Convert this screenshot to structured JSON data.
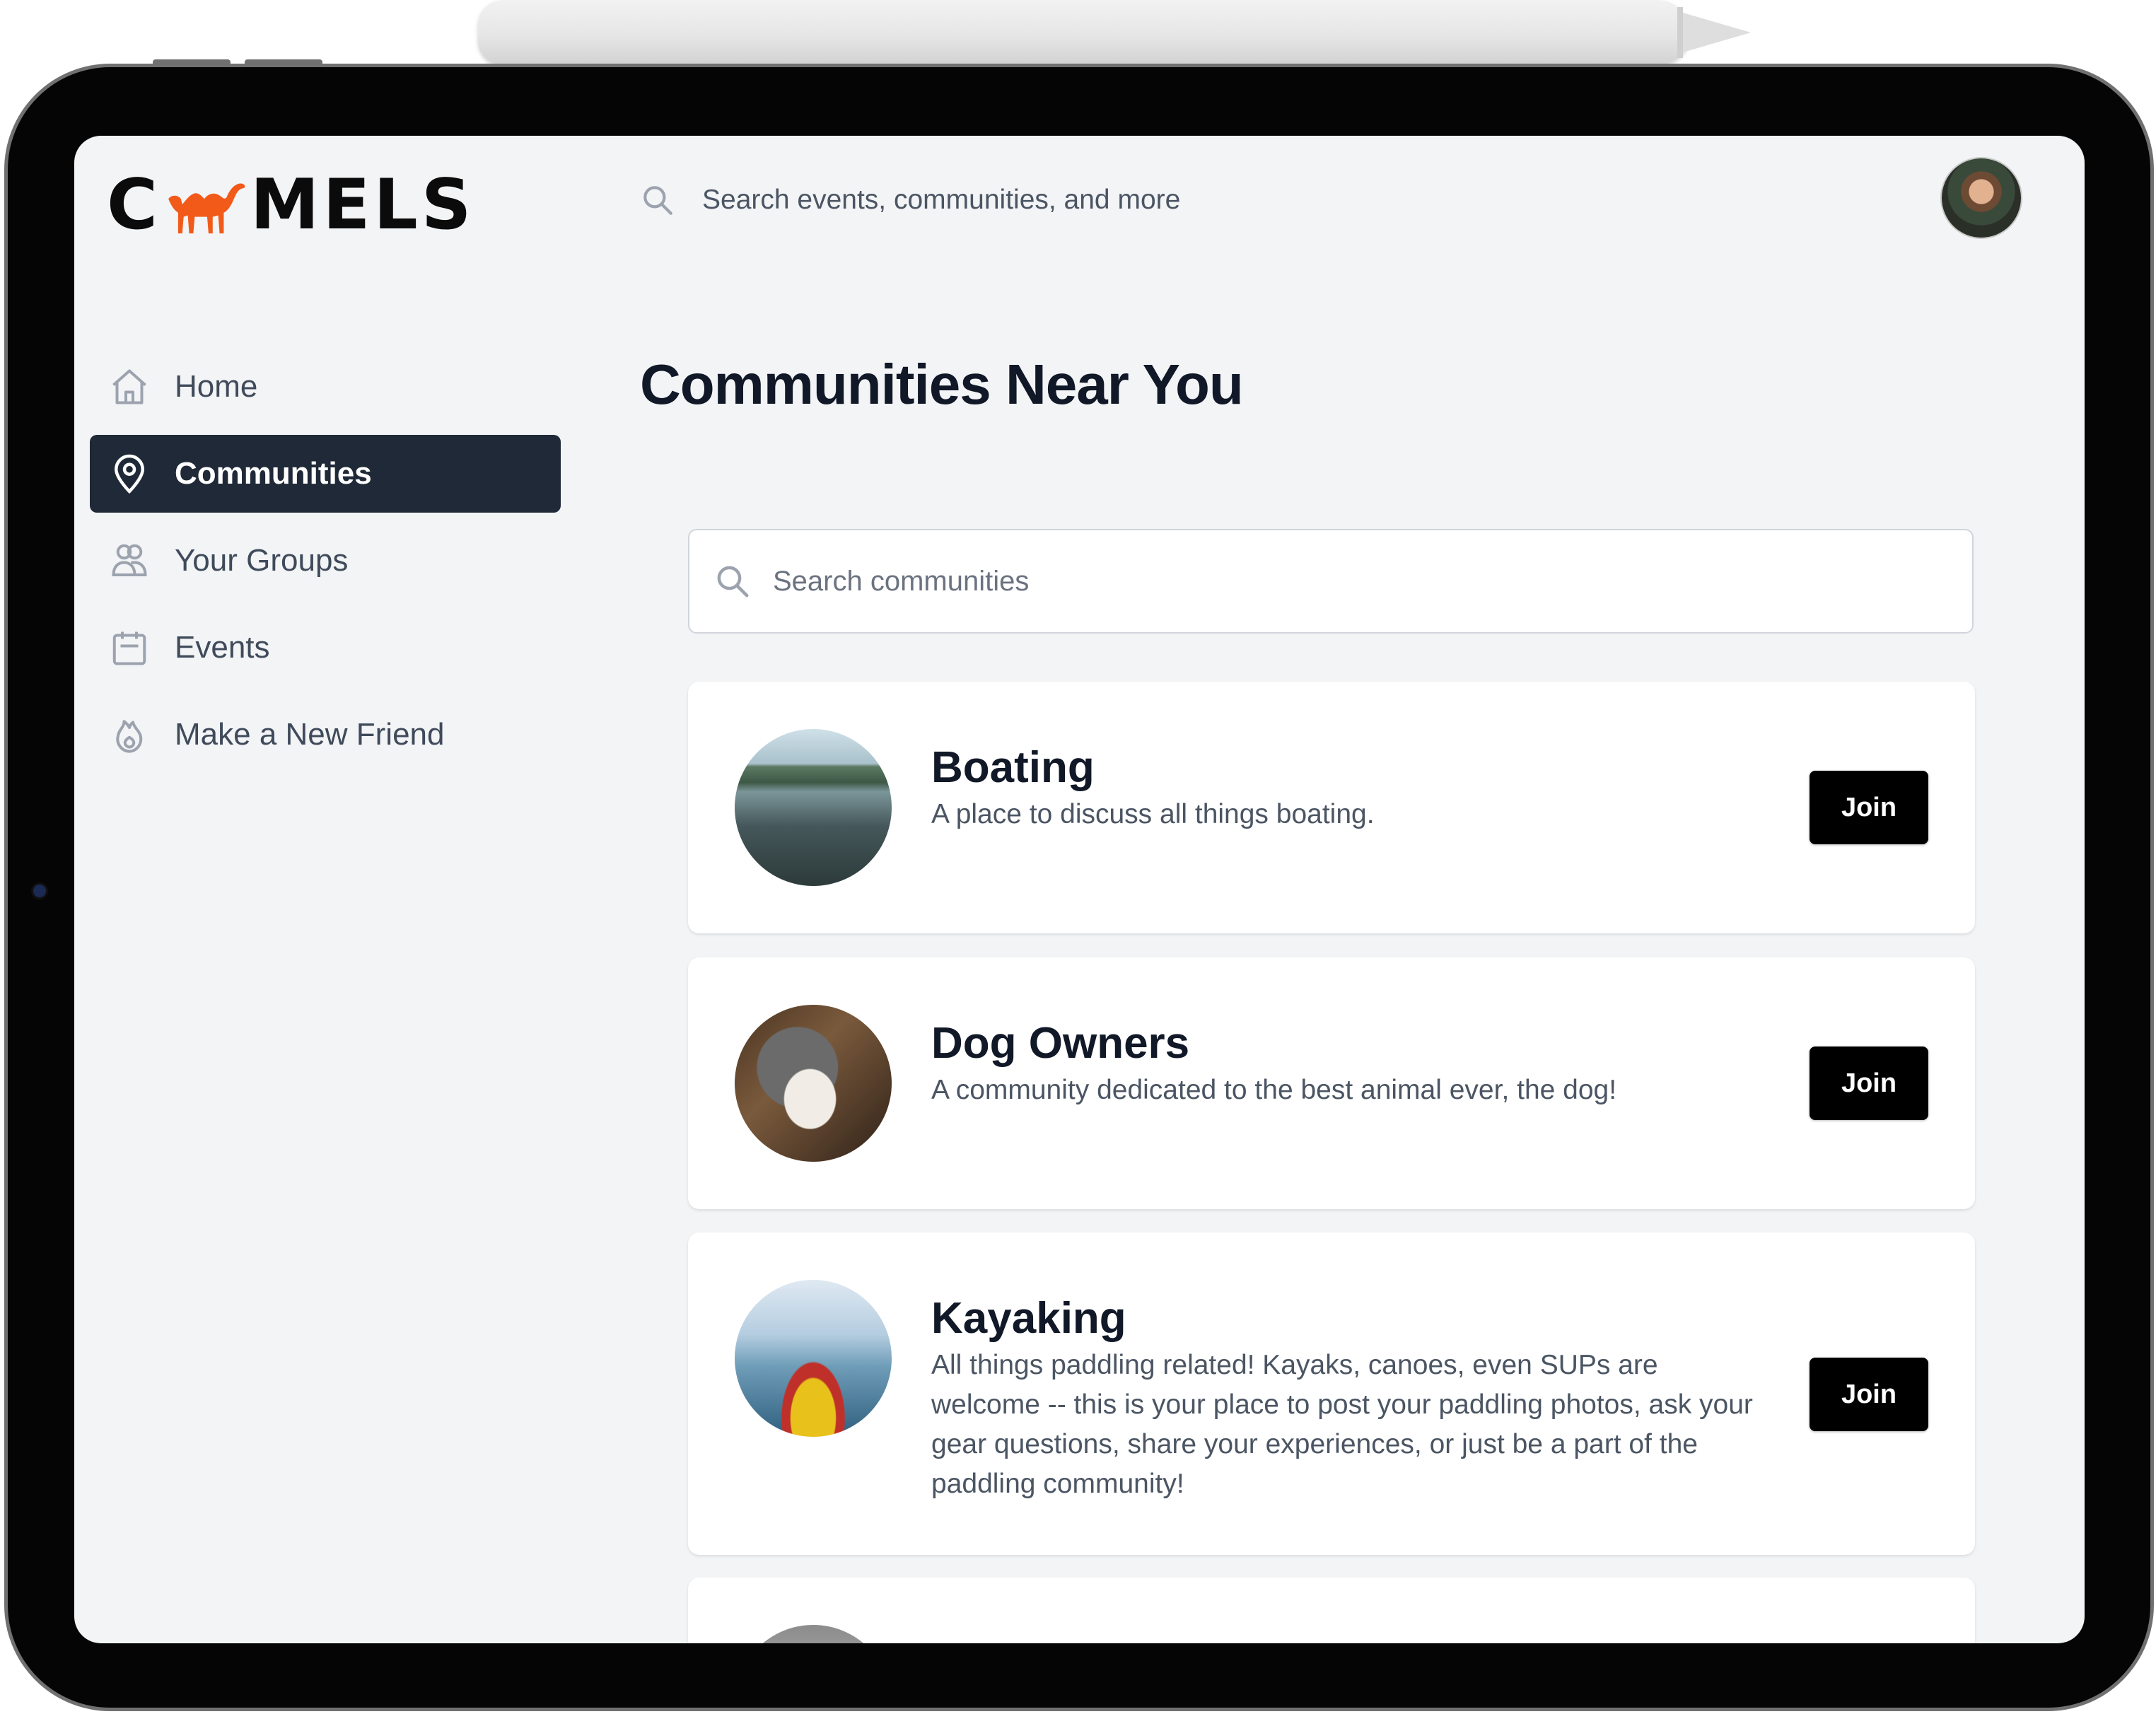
{
  "app": {
    "logo_text_left": "C",
    "logo_text_right": "MELS",
    "brand_color": "#f25a1a"
  },
  "header": {
    "search_placeholder": "Search events, communities, and more",
    "search_icon": "search-icon",
    "avatar": "user-avatar"
  },
  "sidebar": {
    "items": [
      {
        "label": "Home",
        "icon": "home-icon",
        "active": false
      },
      {
        "label": "Communities",
        "icon": "map-pin-icon",
        "active": true
      },
      {
        "label": "Your Groups",
        "icon": "users-icon",
        "active": false
      },
      {
        "label": "Events",
        "icon": "calendar-icon",
        "active": false
      },
      {
        "label": "Make a New Friend",
        "icon": "fire-icon",
        "active": false
      }
    ]
  },
  "main": {
    "title": "Communities Near You",
    "search_placeholder": "Search communities",
    "communities": [
      {
        "name": "Boating",
        "description": "A place to discuss all things boating.",
        "join_label": "Join",
        "image": "boat-on-lake-photo"
      },
      {
        "name": "Dog Owners",
        "description": "A community dedicated to the best animal ever, the dog!",
        "join_label": "Join",
        "image": "dog-photo"
      },
      {
        "name": "Kayaking",
        "description": "All things paddling related! Kayaks, canoes, even SUPs are welcome -- this is your place to post your paddling photos, ask your gear questions, share your experiences, or just be a part of the paddling community!",
        "join_label": "Join",
        "image": "kayak-photo"
      }
    ]
  }
}
